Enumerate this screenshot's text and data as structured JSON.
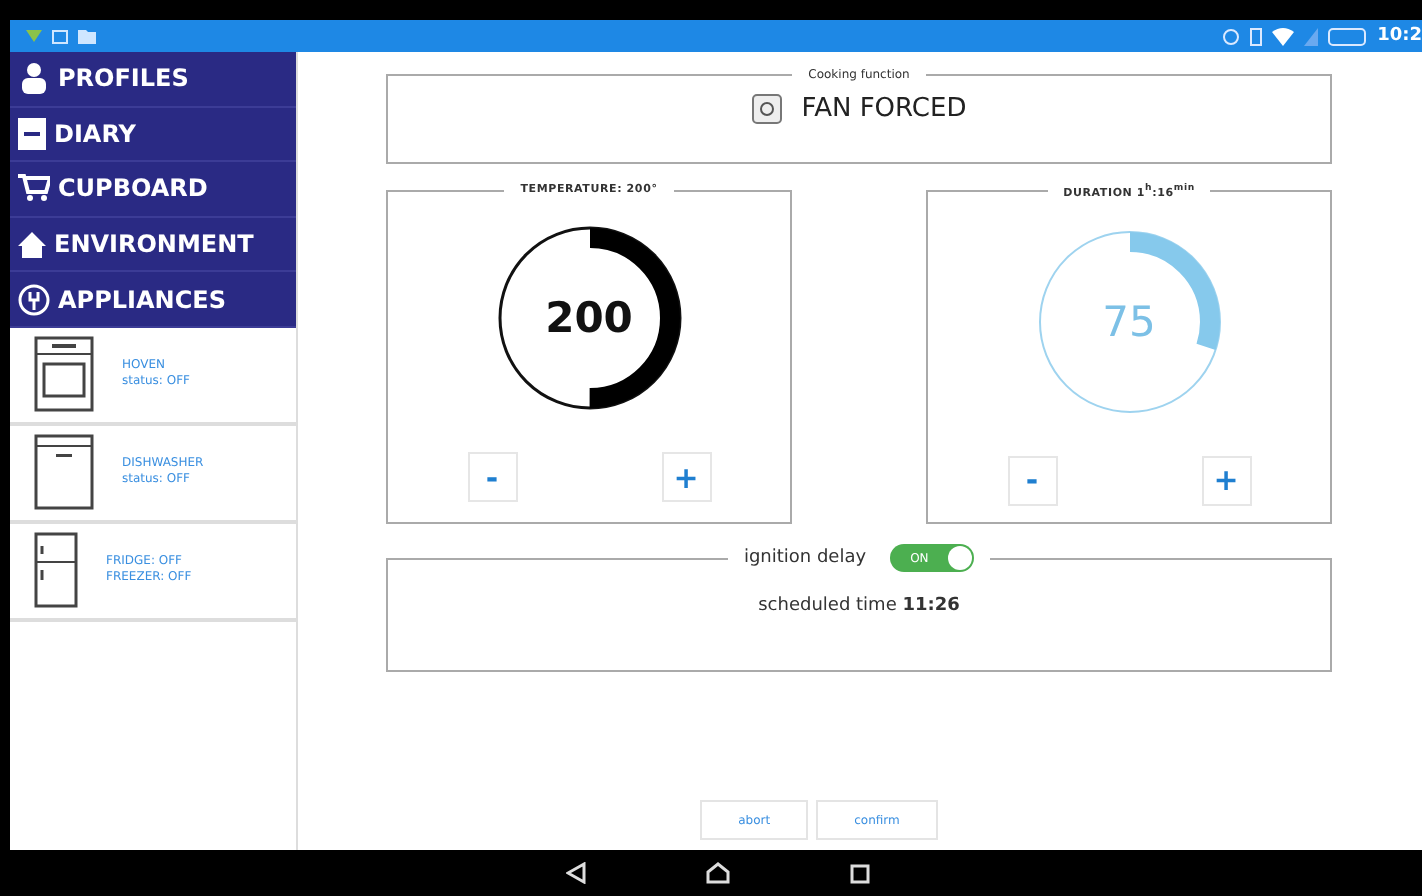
{
  "status_bar": {
    "time": "10:2"
  },
  "sidebar": {
    "items": [
      {
        "label": "PROFILES",
        "kind": "profiles"
      },
      {
        "label": "DIARY",
        "kind": "diary"
      },
      {
        "label": "CUPBOARD",
        "kind": "cupboard"
      },
      {
        "label": "ENVIRONMENT",
        "kind": "environment"
      },
      {
        "label": "APPLIANCES",
        "kind": "appliances"
      }
    ],
    "appliances": [
      {
        "kind": "oven",
        "lines": [
          "HOVEN",
          "status: OFF"
        ]
      },
      {
        "kind": "dishwasher",
        "lines": [
          "DISHWASHER",
          "status: OFF"
        ]
      },
      {
        "kind": "fridge",
        "lines": [
          "FRIDGE: OFF",
          "FREEZER: OFF"
        ]
      }
    ]
  },
  "cooking_function": {
    "legend": "Cooking function",
    "value": "FAN FORCED"
  },
  "dials": [
    {
      "legend": "TEMPERATURE: 200°",
      "reading": "200",
      "level": 0.5,
      "kind": "dark",
      "minus": "-",
      "plus": "+"
    },
    {
      "legend": "DURATION 1$^{h}$:16$^{min}$",
      "reading": "75",
      "level": 0.3,
      "kind": "light",
      "minus": "-",
      "plus": "+"
    }
  ],
  "ignition": {
    "legend": "ignition delay",
    "toggle": {
      "label": "ON",
      "on": true
    },
    "scheduled": "scheduled time **11:26**"
  },
  "buttons": [
    "abort",
    "confirm"
  ]
}
